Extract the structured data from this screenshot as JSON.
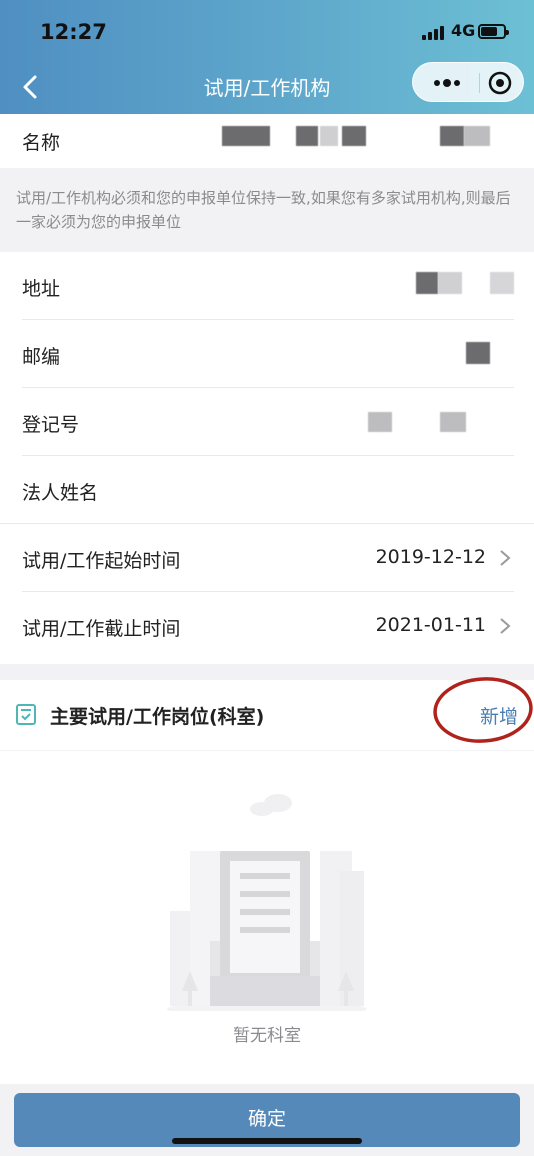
{
  "status_bar": {
    "time": "12:27",
    "network": "4G"
  },
  "nav": {
    "title": "试用/工作机构"
  },
  "form": {
    "name_label": "名称",
    "notice": "试用/工作机构必须和您的申报单位保持一致,如果您有多家试用机构,则最后一家必须为您的申报单位",
    "address_label": "地址",
    "postcode_label": "邮编",
    "registration_label": "登记号",
    "legal_person_label": "法人姓名",
    "start_label": "试用/工作起始时间",
    "start_value": "2019-12-12",
    "end_label": "试用/工作截止时间",
    "end_value": "2021-01-11"
  },
  "section": {
    "title": "主要试用/工作岗位(科室)",
    "add_label": "新增",
    "annotation_color": "#b0221c"
  },
  "empty": {
    "text": "暂无科室"
  },
  "footer": {
    "confirm_label": "确定"
  },
  "colors": {
    "accent": "#5489ba",
    "link": "#4a7fb3",
    "header_start": "#4f8fc2",
    "header_end": "#6cc0d4"
  }
}
